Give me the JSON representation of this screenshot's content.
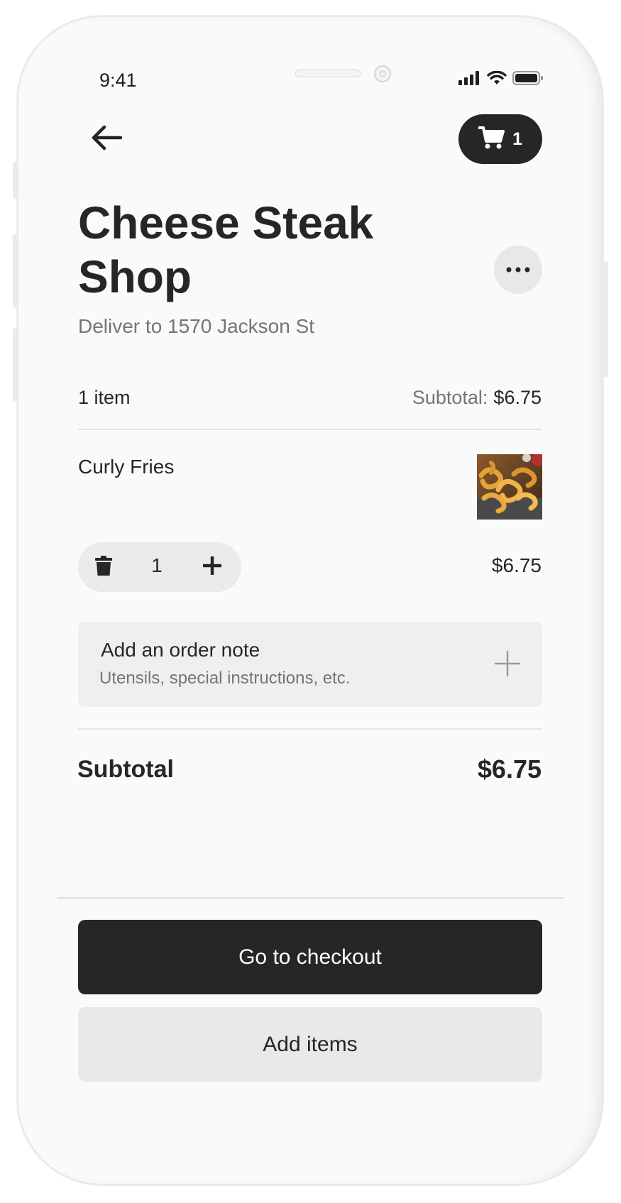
{
  "status_bar": {
    "time": "9:41",
    "icons": [
      "cellular-signal-icon",
      "wifi-icon",
      "battery-icon"
    ]
  },
  "header": {
    "back_icon": "arrow-left-icon",
    "cart_icon": "cart-icon",
    "cart_count": "1"
  },
  "store": {
    "name": "Cheese Steak Shop",
    "more_icon": "more-horizontal-icon",
    "deliver_to": "Deliver to 1570 Jackson St"
  },
  "summary": {
    "item_count": "1 item",
    "subtotal_label": "Subtotal:",
    "subtotal_value": "$6.75"
  },
  "items": [
    {
      "name": "Curly Fries",
      "quantity": "1",
      "price": "$6.75",
      "remove_icon": "trash-icon",
      "increment_icon": "plus-icon"
    }
  ],
  "order_note": {
    "title": "Add an order note",
    "subtitle": "Utensils, special instructions, etc.",
    "icon": "plus-icon"
  },
  "totals": {
    "label": "Subtotal",
    "value": "$6.75"
  },
  "actions": {
    "checkout_label": "Go to checkout",
    "add_items_label": "Add items"
  },
  "colors": {
    "primary_dark": "#262626",
    "background": "#fafafa",
    "muted_text": "#757575",
    "surface_light": "#efefef"
  }
}
